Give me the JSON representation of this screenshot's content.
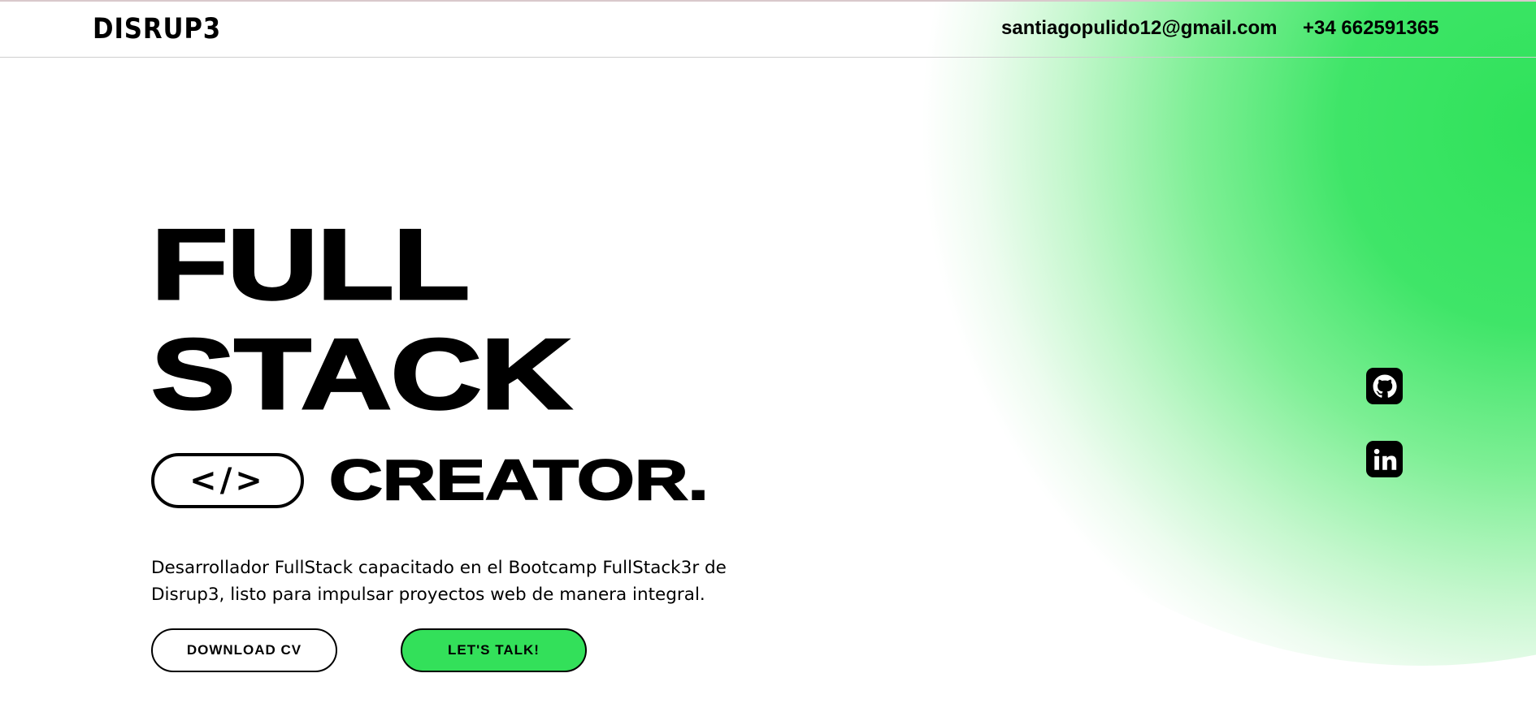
{
  "header": {
    "logo": "DISRUP3",
    "email": "santiagopulido12@gmail.com",
    "phone": "+34 662591365"
  },
  "hero": {
    "line1": "FULL",
    "line2": "STACK",
    "code_symbol": "</>",
    "line3": "CREATOR.",
    "description_line1": "Desarrollador FullStack capacitado en el Bootcamp FullStack3r de",
    "description_line2": "Disrup3, listo para impulsar proyectos web de manera integral."
  },
  "buttons": {
    "download_cv": "DOWNLOAD CV",
    "lets_talk": "LET'S TALK!"
  },
  "social": {
    "github_icon": "github-icon",
    "linkedin_icon": "linkedin-icon",
    "linkedin_text": "in"
  },
  "colors": {
    "accent": "#33e05a",
    "text": "#000000",
    "background": "#ffffff"
  }
}
